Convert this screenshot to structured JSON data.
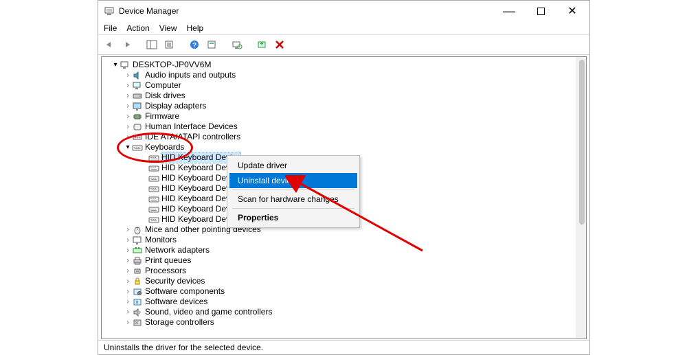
{
  "title": "Device Manager",
  "menus": {
    "file": "File",
    "action": "Action",
    "view": "View",
    "help": "Help"
  },
  "root_name": "DESKTOP-JP0VV6M",
  "categories": [
    {
      "label": "Audio inputs and outputs",
      "icon": "audio"
    },
    {
      "label": "Computer",
      "icon": "computer"
    },
    {
      "label": "Disk drives",
      "icon": "disk"
    },
    {
      "label": "Display adapters",
      "icon": "display"
    },
    {
      "label": "Firmware",
      "icon": "chip"
    },
    {
      "label": "Human Interface Devices",
      "icon": "hid"
    },
    {
      "label": "IDE ATA/ATAPI controllers",
      "icon": "ide"
    },
    {
      "label": "Keyboards",
      "icon": "keyboard",
      "expanded": true,
      "children": [
        "HID Keyboard Device",
        "HID Keyboard Device",
        "HID Keyboard Device",
        "HID Keyboard Device",
        "HID Keyboard Device",
        "HID Keyboard Device",
        "HID Keyboard Device"
      ]
    },
    {
      "label": "Mice and other pointing devices",
      "icon": "mouse"
    },
    {
      "label": "Monitors",
      "icon": "monitor"
    },
    {
      "label": "Network adapters",
      "icon": "net"
    },
    {
      "label": "Print queues",
      "icon": "printer"
    },
    {
      "label": "Processors",
      "icon": "cpu"
    },
    {
      "label": "Security devices",
      "icon": "security"
    },
    {
      "label": "Software components",
      "icon": "swcomp"
    },
    {
      "label": "Software devices",
      "icon": "swdev"
    },
    {
      "label": "Sound, video and game controllers",
      "icon": "sound"
    },
    {
      "label": "Storage controllers",
      "icon": "storage"
    }
  ],
  "context_menu": {
    "update": "Update driver",
    "uninstall": "Uninstall device",
    "scan": "Scan for hardware changes",
    "properties": "Properties"
  },
  "status_text": "Uninstalls the driver for the selected device."
}
